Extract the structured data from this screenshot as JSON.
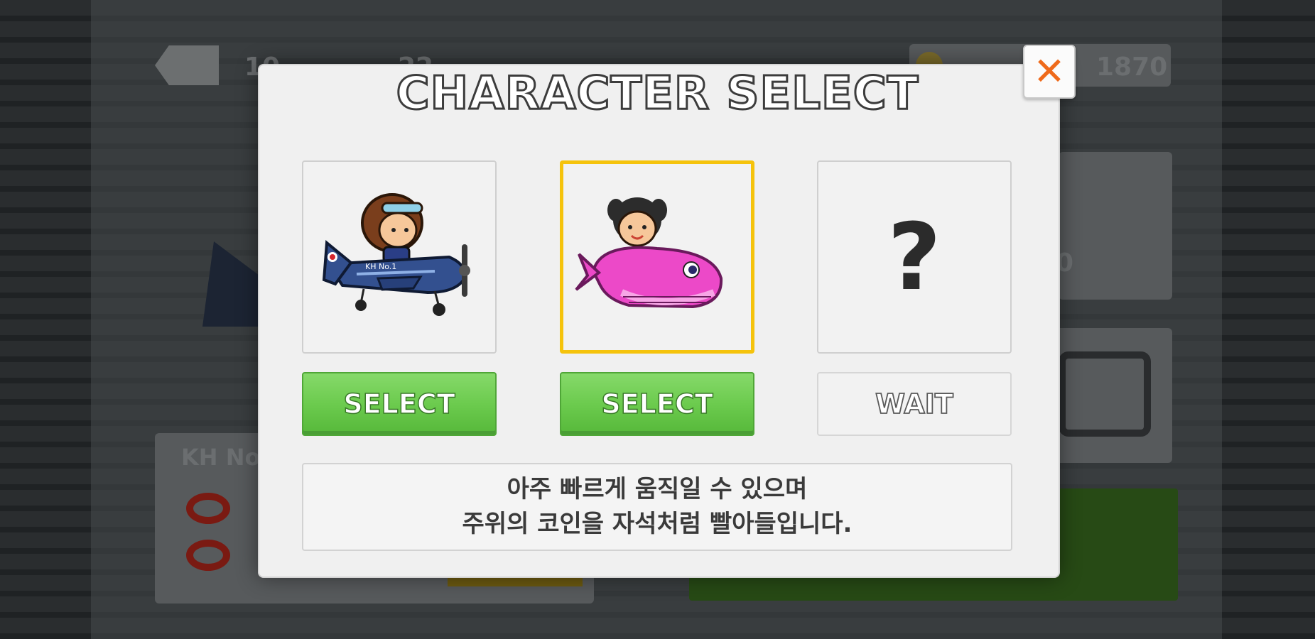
{
  "modal": {
    "title": "CHARACTER SELECT",
    "close_icon": "close-x-icon",
    "accent_color": "#ef6a1a"
  },
  "characters": [
    {
      "id": "pilot-boy-plane",
      "icon": "pilot-boy-blue-plane-icon",
      "plane_text": "KH No.1",
      "button_label": "SELECT",
      "selected": false
    },
    {
      "id": "girl-pink-whale",
      "icon": "girl-riding-pink-whale-icon",
      "button_label": "SELECT",
      "selected": true
    },
    {
      "id": "locked",
      "icon": "question-mark-icon",
      "placeholder": "?",
      "button_label": "WAIT",
      "selected": false
    }
  ],
  "description": {
    "line1": "아주 빠르게 움직일 수 있으며",
    "line2": "주위의 코인을 자석처럼 빨아들입니다."
  },
  "background": {
    "coins": "1870",
    "header_left": "10",
    "header_right": "22",
    "panel_right_value": "0",
    "panel_left_label": "KH No"
  },
  "colors": {
    "select_green": "#6ccb4e",
    "selected_border": "#f5c30c",
    "whale_pink": "#ec49c8",
    "plane_blue": "#33508f"
  }
}
